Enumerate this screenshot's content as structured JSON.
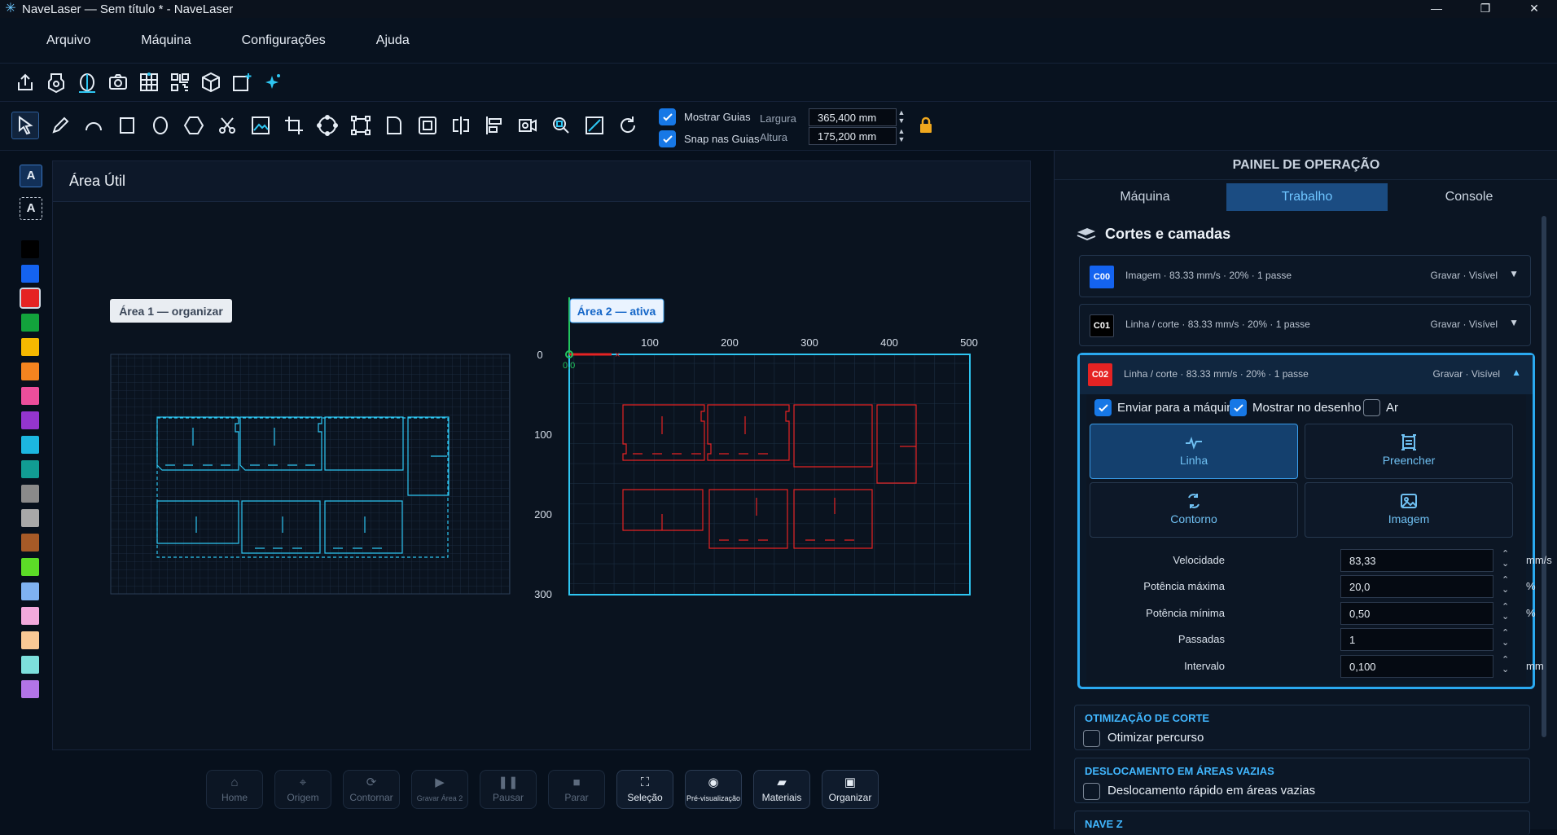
{
  "window": {
    "title": "NaveLaser — Sem título * - NaveLaser",
    "minimize": "—",
    "maximize": "❐",
    "close": "✕"
  },
  "menu": [
    "Arquivo",
    "Máquina",
    "Configurações",
    "Ajuda"
  ],
  "toolbar2": {
    "show_guides": "Mostrar Guias",
    "snap_guides": "Snap nas Guias",
    "width_label": "Largura",
    "width_value": "365,400 mm",
    "height_label": "Altura",
    "height_value": "175,200 mm"
  },
  "left_palette": {
    "text_tool": "A",
    "text_frame_tool": "A",
    "colors": [
      "#000000",
      "#1463f0",
      "#e52323",
      "#12a33c",
      "#f5b800",
      "#f5841f",
      "#ec4e9b",
      "#9435cf",
      "#1cb7e0",
      "#119c93",
      "#8a8a8a",
      "#a8a8a8",
      "#a65a27",
      "#5cdc27",
      "#7fb2f2",
      "#f2a9dc",
      "#f9c995",
      "#7de0dc",
      "#b274e8"
    ]
  },
  "canvas": {
    "title": "Área Útil",
    "area1_label": "Área 1 — organizar",
    "area2_label": "Área 2 — ativa",
    "ruler_x": [
      "100",
      "200",
      "300",
      "400",
      "500"
    ],
    "ruler_y": [
      "0",
      "100",
      "200",
      "300"
    ],
    "origin_label": "0,0"
  },
  "panel": {
    "title": "PAINEL DE OPERAÇÃO",
    "tabs": [
      "Máquina",
      "Trabalho",
      "Console"
    ],
    "section_title": "Cortes e camadas",
    "layers": [
      {
        "code": "C00",
        "desc": "Imagem · 83.33 mm/s · 20% · 1 passe",
        "state": "Gravar · Visível",
        "color": "#1463f0"
      },
      {
        "code": "C01",
        "desc": "Linha / corte · 83.33 mm/s · 20% · 1 passe",
        "state": "Gravar · Visível",
        "color": "#000000"
      },
      {
        "code": "C02",
        "desc": "Linha / corte · 83.33 mm/s · 20% · 1 passe",
        "state": "Gravar · Visível",
        "color": "#e52323"
      }
    ],
    "options": {
      "send": "Enviar para a máquina",
      "show": "Mostrar no desenho",
      "air": "Ar"
    },
    "modes": [
      "Linha",
      "Preencher",
      "Contorno",
      "Imagem"
    ],
    "params": [
      {
        "label": "Velocidade",
        "value": "83,33",
        "unit": "mm/s"
      },
      {
        "label": "Potência máxima",
        "value": "20,0",
        "unit": "%"
      },
      {
        "label": "Potência mínima",
        "value": "0,50",
        "unit": "%"
      },
      {
        "label": "Passadas",
        "value": "1",
        "unit": ""
      },
      {
        "label": "Intervalo",
        "value": "0,100",
        "unit": "mm"
      }
    ],
    "opt_title": "OTIMIZAÇÃO DE CORTE",
    "opt_item": "Otimizar percurso",
    "move_title": "DESLOCAMENTO EM ÁREAS VAZIAS",
    "move_item": "Deslocamento rápido em áreas vazias",
    "z_title": "NAVE Z"
  },
  "bottom": [
    "Home",
    "Origem",
    "Contornar",
    "Gravar Área 2",
    "Pausar",
    "Parar",
    "Seleção",
    "Pré-visualização",
    "Materiais",
    "Organizar"
  ],
  "colors": {
    "accent": "#1778e6",
    "cyan": "#2ec6f2",
    "red": "#e52323"
  }
}
